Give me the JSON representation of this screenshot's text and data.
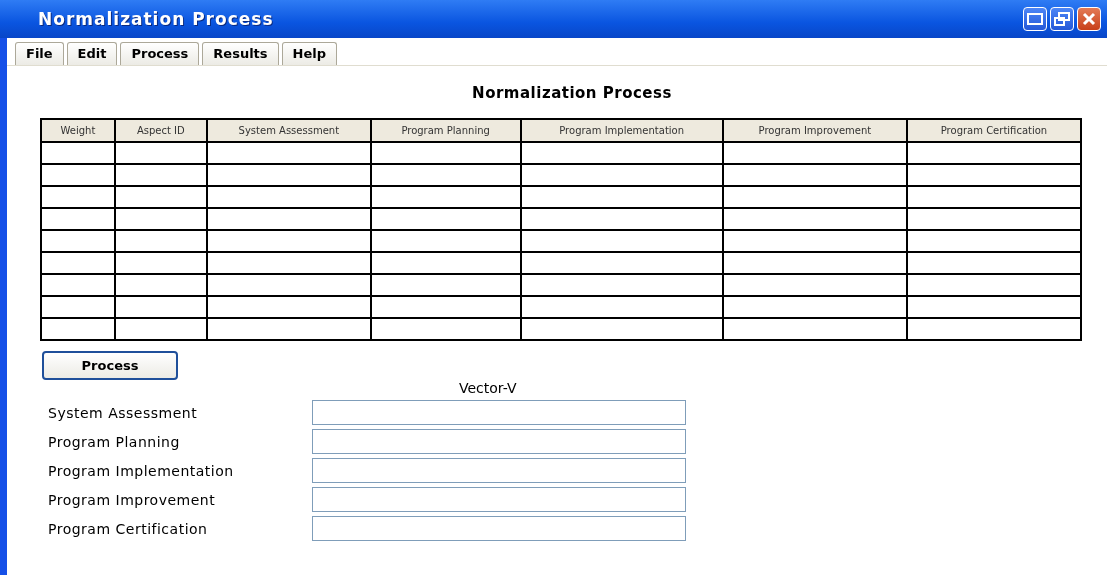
{
  "window": {
    "title": "Normalization Process"
  },
  "tabs": [
    {
      "label": "File",
      "selected": false
    },
    {
      "label": "Edit",
      "selected": false
    },
    {
      "label": "Process",
      "selected": false
    },
    {
      "label": "Results",
      "selected": false
    },
    {
      "label": "Help",
      "selected": false
    }
  ],
  "heading": "Normalization Process",
  "table": {
    "columns": [
      "Weight",
      "Aspect ID",
      "System Assessment",
      "Program Planning",
      "Program Implementation",
      "Program Improvement",
      "Program Certification"
    ]
  },
  "process_button": "Process",
  "vector_v": {
    "title": "Vector-V",
    "fields": [
      {
        "label": "System Assessment"
      },
      {
        "label": "Program Planning"
      },
      {
        "label": "Program Implementation"
      },
      {
        "label": "Program Improvement"
      },
      {
        "label": "Program Certification"
      }
    ]
  }
}
